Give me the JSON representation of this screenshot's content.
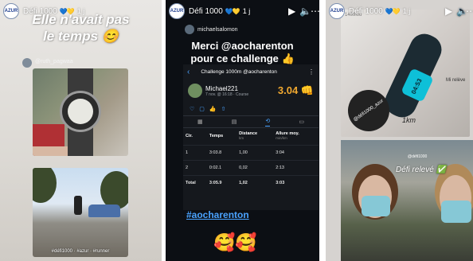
{
  "stories": [
    {
      "username": "Défi 1000",
      "time": "1 j",
      "avatar_text": "AZUR",
      "caption_line1": "Elle n'avait pas",
      "caption_line2": "le temps 😊",
      "inner_username": "@ruth_pagwaa",
      "run_caption": "#défi1000 · #azur · #runner"
    },
    {
      "username": "Défi 1000",
      "time": "1 j",
      "avatar_text": "AZUR",
      "inner_username": "michaelsalomon",
      "merci_line1": "Merci @aocharenton",
      "merci_line2": "pour ce challenge 👍",
      "card_title": "Challenge 1000m @aocharenton",
      "athlete": "Michael221",
      "athlete_sub": "7 nov. @ 16:18 · Course",
      "value": "3.04 👊",
      "table_headers": [
        {
          "title": "Cir.",
          "unit": ""
        },
        {
          "title": "Temps",
          "unit": ""
        },
        {
          "title": "Distance",
          "unit": "km"
        },
        {
          "title": "Allure moy.",
          "unit": "min/km"
        }
      ],
      "table_rows": [
        [
          "1",
          "3:03.8",
          "1,00",
          "3:04"
        ],
        [
          "2",
          "0:02.1",
          "0,02",
          "2:13"
        ]
      ],
      "table_total": [
        "Total",
        "3:05.9",
        "1,02",
        "3:03"
      ],
      "hashtag": "#aocharenton",
      "emojis": "🥰🥰"
    },
    {
      "username": "Défi 1000",
      "time": "1 j",
      "avatar_text": "AZUR",
      "inner_username": "1459lou",
      "band_time": "04:53",
      "km_note": "1km",
      "steps_note": "Mi relève",
      "sticker_text": "@défi1000_azur",
      "defi_text": "Défi relevé ✅",
      "ig_handle": "@défi1000"
    }
  ],
  "colors": {
    "accent_blue": "#4aa3ff",
    "value_orange": "#f0a830",
    "dark_bg": "#0c0f14"
  }
}
